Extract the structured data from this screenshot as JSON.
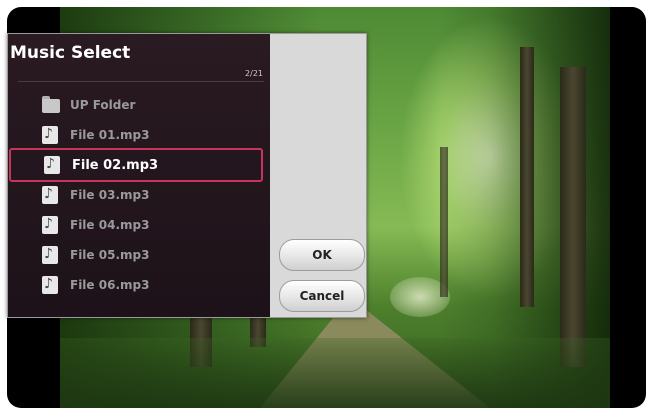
{
  "dialog": {
    "title": "Music Select",
    "page_indicator": "2/21",
    "items": [
      {
        "label": "UP Folder",
        "icon": "folder-up-icon"
      },
      {
        "label": "File 01.mp3",
        "icon": "music-file-icon"
      },
      {
        "label": "File 02.mp3",
        "icon": "music-file-icon",
        "selected": true
      },
      {
        "label": "File 03.mp3",
        "icon": "music-file-icon"
      },
      {
        "label": "File 04.mp3",
        "icon": "music-file-icon"
      },
      {
        "label": "File 05.mp3",
        "icon": "music-file-icon"
      },
      {
        "label": "File 06.mp3",
        "icon": "music-file-icon"
      }
    ],
    "buttons": {
      "ok": "OK",
      "cancel": "Cancel"
    }
  },
  "colors": {
    "panel_bg": "#2a1a22",
    "selection_border": "#c8355a",
    "item_text": "#9a9a9a",
    "selected_text": "#ffffff"
  }
}
